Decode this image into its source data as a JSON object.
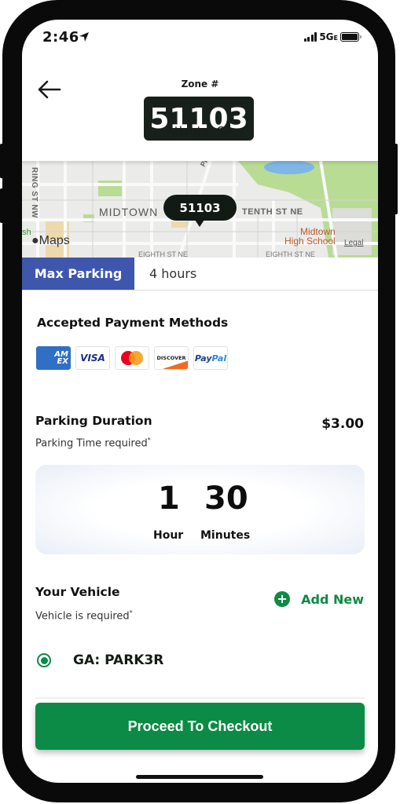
{
  "status_bar": {
    "time": "2:46",
    "network": "5G",
    "network_suffix": "E"
  },
  "header": {
    "zone_label": "Zone #",
    "zone_number": "51103",
    "city": "Atlanta, GA"
  },
  "map": {
    "pin_label": "51103",
    "labels": {
      "district": "MIDTOWN",
      "street_tenth": "TENTH ST NE",
      "street_spring": "RING ST NW",
      "street_piedmont": "PIEDM",
      "attribution": "Maps",
      "partial": "sh",
      "school_line1": "Midtown",
      "school_line2": "High School",
      "legal": "Legal",
      "street_eighth": "EIGHTH ST NE"
    }
  },
  "max_parking": {
    "label": "Max Parking",
    "value": "4 hours"
  },
  "payment": {
    "title": "Accepted Payment Methods",
    "methods": [
      "American Express",
      "Visa",
      "Mastercard",
      "Discover",
      "PayPal"
    ],
    "amex_text": "AM EX",
    "visa_text": "VISA",
    "discover_text": "DISCOVER",
    "paypal_a": "Pay",
    "paypal_b": "Pal"
  },
  "duration": {
    "title": "Parking Duration",
    "price": "$3.00",
    "subtitle": "Parking Time required",
    "required_mark": "*",
    "hours": "1",
    "minutes": "30",
    "hour_label": "Hour",
    "minutes_label": "Minutes"
  },
  "vehicle": {
    "title": "Your Vehicle",
    "subtitle": "Vehicle is required",
    "required_mark": "*",
    "add_new_label": "Add New",
    "selected_plate": "GA: PARK3R"
  },
  "checkout": {
    "label": "Proceed To Checkout"
  },
  "colors": {
    "primary_green": "#0b8b45",
    "max_parking_blue": "#3e57ad",
    "zone_box": "#17201a"
  }
}
